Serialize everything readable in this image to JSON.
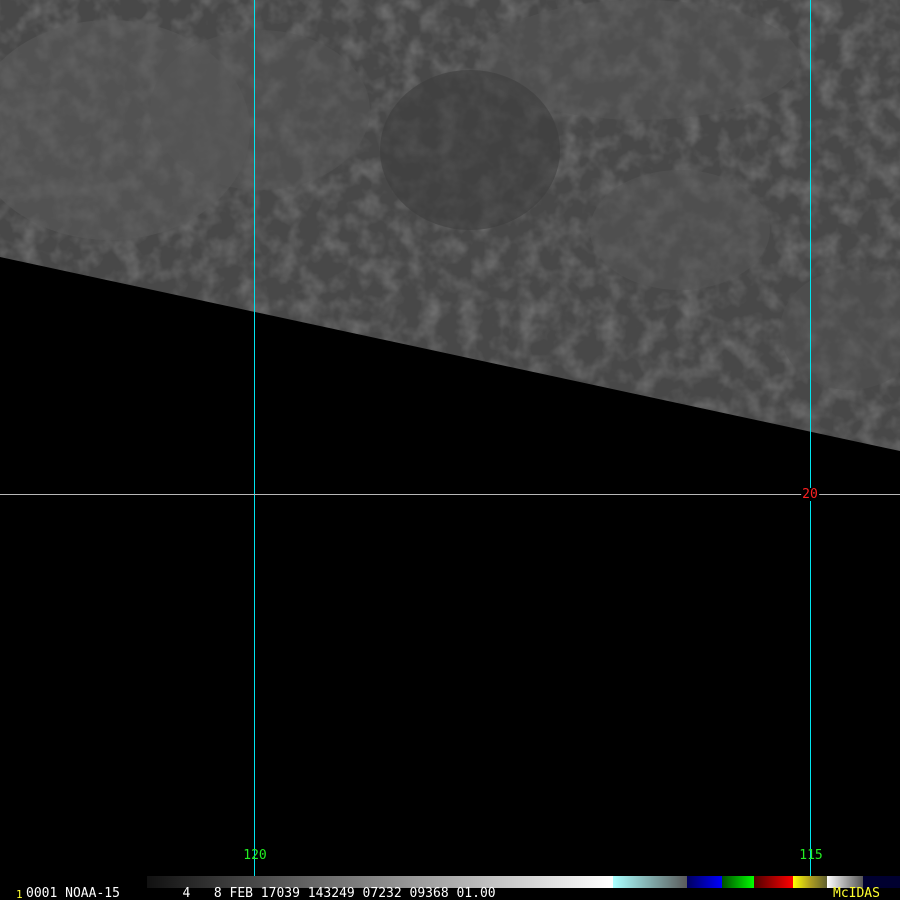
{
  "satellite_image": {
    "frame_number": "1",
    "info_line": "0001 NOAA-15        4   8 FEB 17039 143249 07232 09368 01.00",
    "software_logo": "McIDAS",
    "grid": {
      "longitude_labels": [
        "120",
        "115"
      ],
      "latitude_labels": [
        "20"
      ]
    },
    "colors": {
      "grid_meridian": "#00e5f0",
      "grid_parallel": "#b8b8b8",
      "lon_label": "#22ee22",
      "lat_label": "#ff2020",
      "logo": "#ffff30"
    }
  }
}
